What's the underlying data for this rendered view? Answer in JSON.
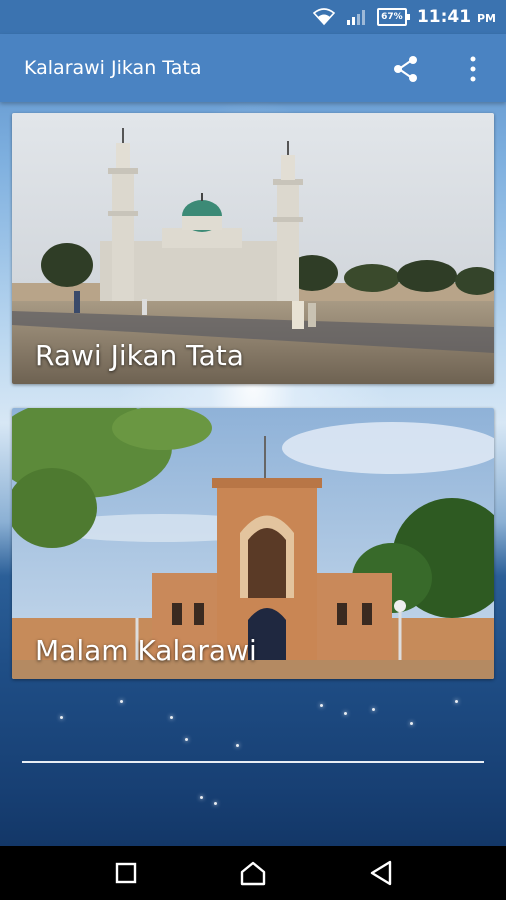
{
  "status_bar": {
    "battery": "67%",
    "time": "11:41",
    "ampm": "PM"
  },
  "app_bar": {
    "title": "Kalarawi Jikan Tata"
  },
  "cards": [
    {
      "label": "Rawi Jikan Tata"
    },
    {
      "label": "Malam Kalarawi"
    }
  ],
  "icons": {
    "wifi": "wifi-icon",
    "signal": "signal-icon",
    "share": "share-icon",
    "more": "more-vert-icon",
    "nav_recent": "square-icon",
    "nav_home": "home-icon",
    "nav_back": "back-triangle-icon"
  }
}
